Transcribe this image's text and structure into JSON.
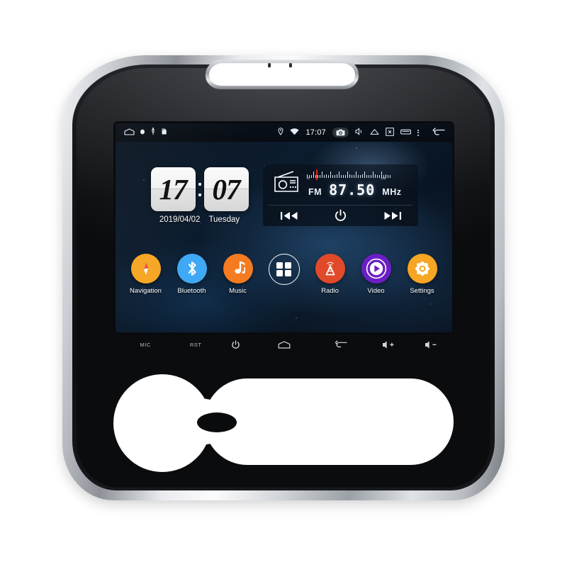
{
  "device": {
    "name": "car-head-unit",
    "trim_color": "#b9bdc3",
    "fascia_color": "#0b0c0e"
  },
  "screen": {
    "wallpaper": "space-nebula",
    "statusbar": {
      "left_icons": [
        "home-outline-icon",
        "dot-icon",
        "usb-icon",
        "sdcard-icon"
      ],
      "location_icon": "location-pin-icon",
      "wifi_icon": "wifi-icon",
      "time": "17:07",
      "camera_icon": "camera-icon",
      "volume_icon": "volume-mute-icon",
      "eject_icon": "eject-icon",
      "screenshot_icon": "screenshot-icon",
      "recents_icon": "recents-icon",
      "overflow_icon": "more-vertical-icon",
      "back_icon": "back-arrow-icon"
    },
    "clock_widget": {
      "hours": "17",
      "minutes": "07",
      "date": "2019/04/02",
      "weekday": "Tuesday"
    },
    "radio_widget": {
      "icon": "radio-icon",
      "band": "FM",
      "frequency": "87.50",
      "unit": "MHz",
      "scale_min": "87",
      "scale_max": "108",
      "needle_color": "#e02a17",
      "prev_label": "prev-track-icon",
      "power_label": "power-icon",
      "next_label": "next-track-icon"
    },
    "apps": [
      {
        "label": "Navigation",
        "icon": "compass-icon",
        "color": "#f5a623",
        "style": "filled"
      },
      {
        "label": "Bluetooth",
        "icon": "bluetooth-icon",
        "color": "#3fa9f5",
        "style": "filled"
      },
      {
        "label": "Music",
        "icon": "music-note-icon",
        "color": "#f47b20",
        "style": "filled"
      },
      {
        "label": "",
        "icon": "apps-grid-icon",
        "color": "#ffffff",
        "style": "ring"
      },
      {
        "label": "Radio",
        "icon": "radio-tower-icon",
        "color": "#e04a2a",
        "style": "filled"
      },
      {
        "label": "Video",
        "icon": "play-icon",
        "color": "#6a1fc4",
        "style": "filled"
      },
      {
        "label": "Settings",
        "icon": "gear-icon",
        "color": "#f5a623",
        "style": "filled"
      }
    ]
  },
  "hardware_keys": [
    {
      "label": "MIC",
      "icon": "mic-label",
      "type": "text"
    },
    {
      "label": "RST",
      "icon": "reset-label",
      "type": "text"
    },
    {
      "label": "",
      "icon": "power-icon",
      "type": "icon"
    },
    {
      "label": "",
      "icon": "home-icon",
      "type": "icon"
    },
    {
      "label": "",
      "icon": "back-icon",
      "type": "icon"
    },
    {
      "label": "",
      "icon": "volume-up-icon",
      "type": "icon"
    },
    {
      "label": "",
      "icon": "volume-down-icon",
      "type": "icon"
    }
  ]
}
